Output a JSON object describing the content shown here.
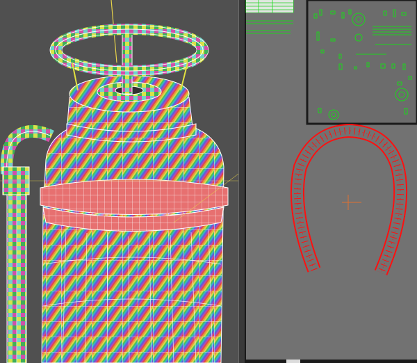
{
  "viewports": {
    "left": {
      "kind": "perspective-3d",
      "object": "extinguisher-wireframe-checker",
      "gizmo_axis": "z"
    },
    "right": {
      "kind": "uv-editor",
      "object": "horseshoe-handle-uv-island",
      "highlight_color": "#ff1010",
      "uv_line_color": "#1cd61c"
    }
  },
  "colors": {
    "wire": "#ffffff",
    "selection": "#ff2222",
    "uv_lines": "#1cd61c",
    "background_3d": "#505050",
    "background_uv": "#727272"
  }
}
